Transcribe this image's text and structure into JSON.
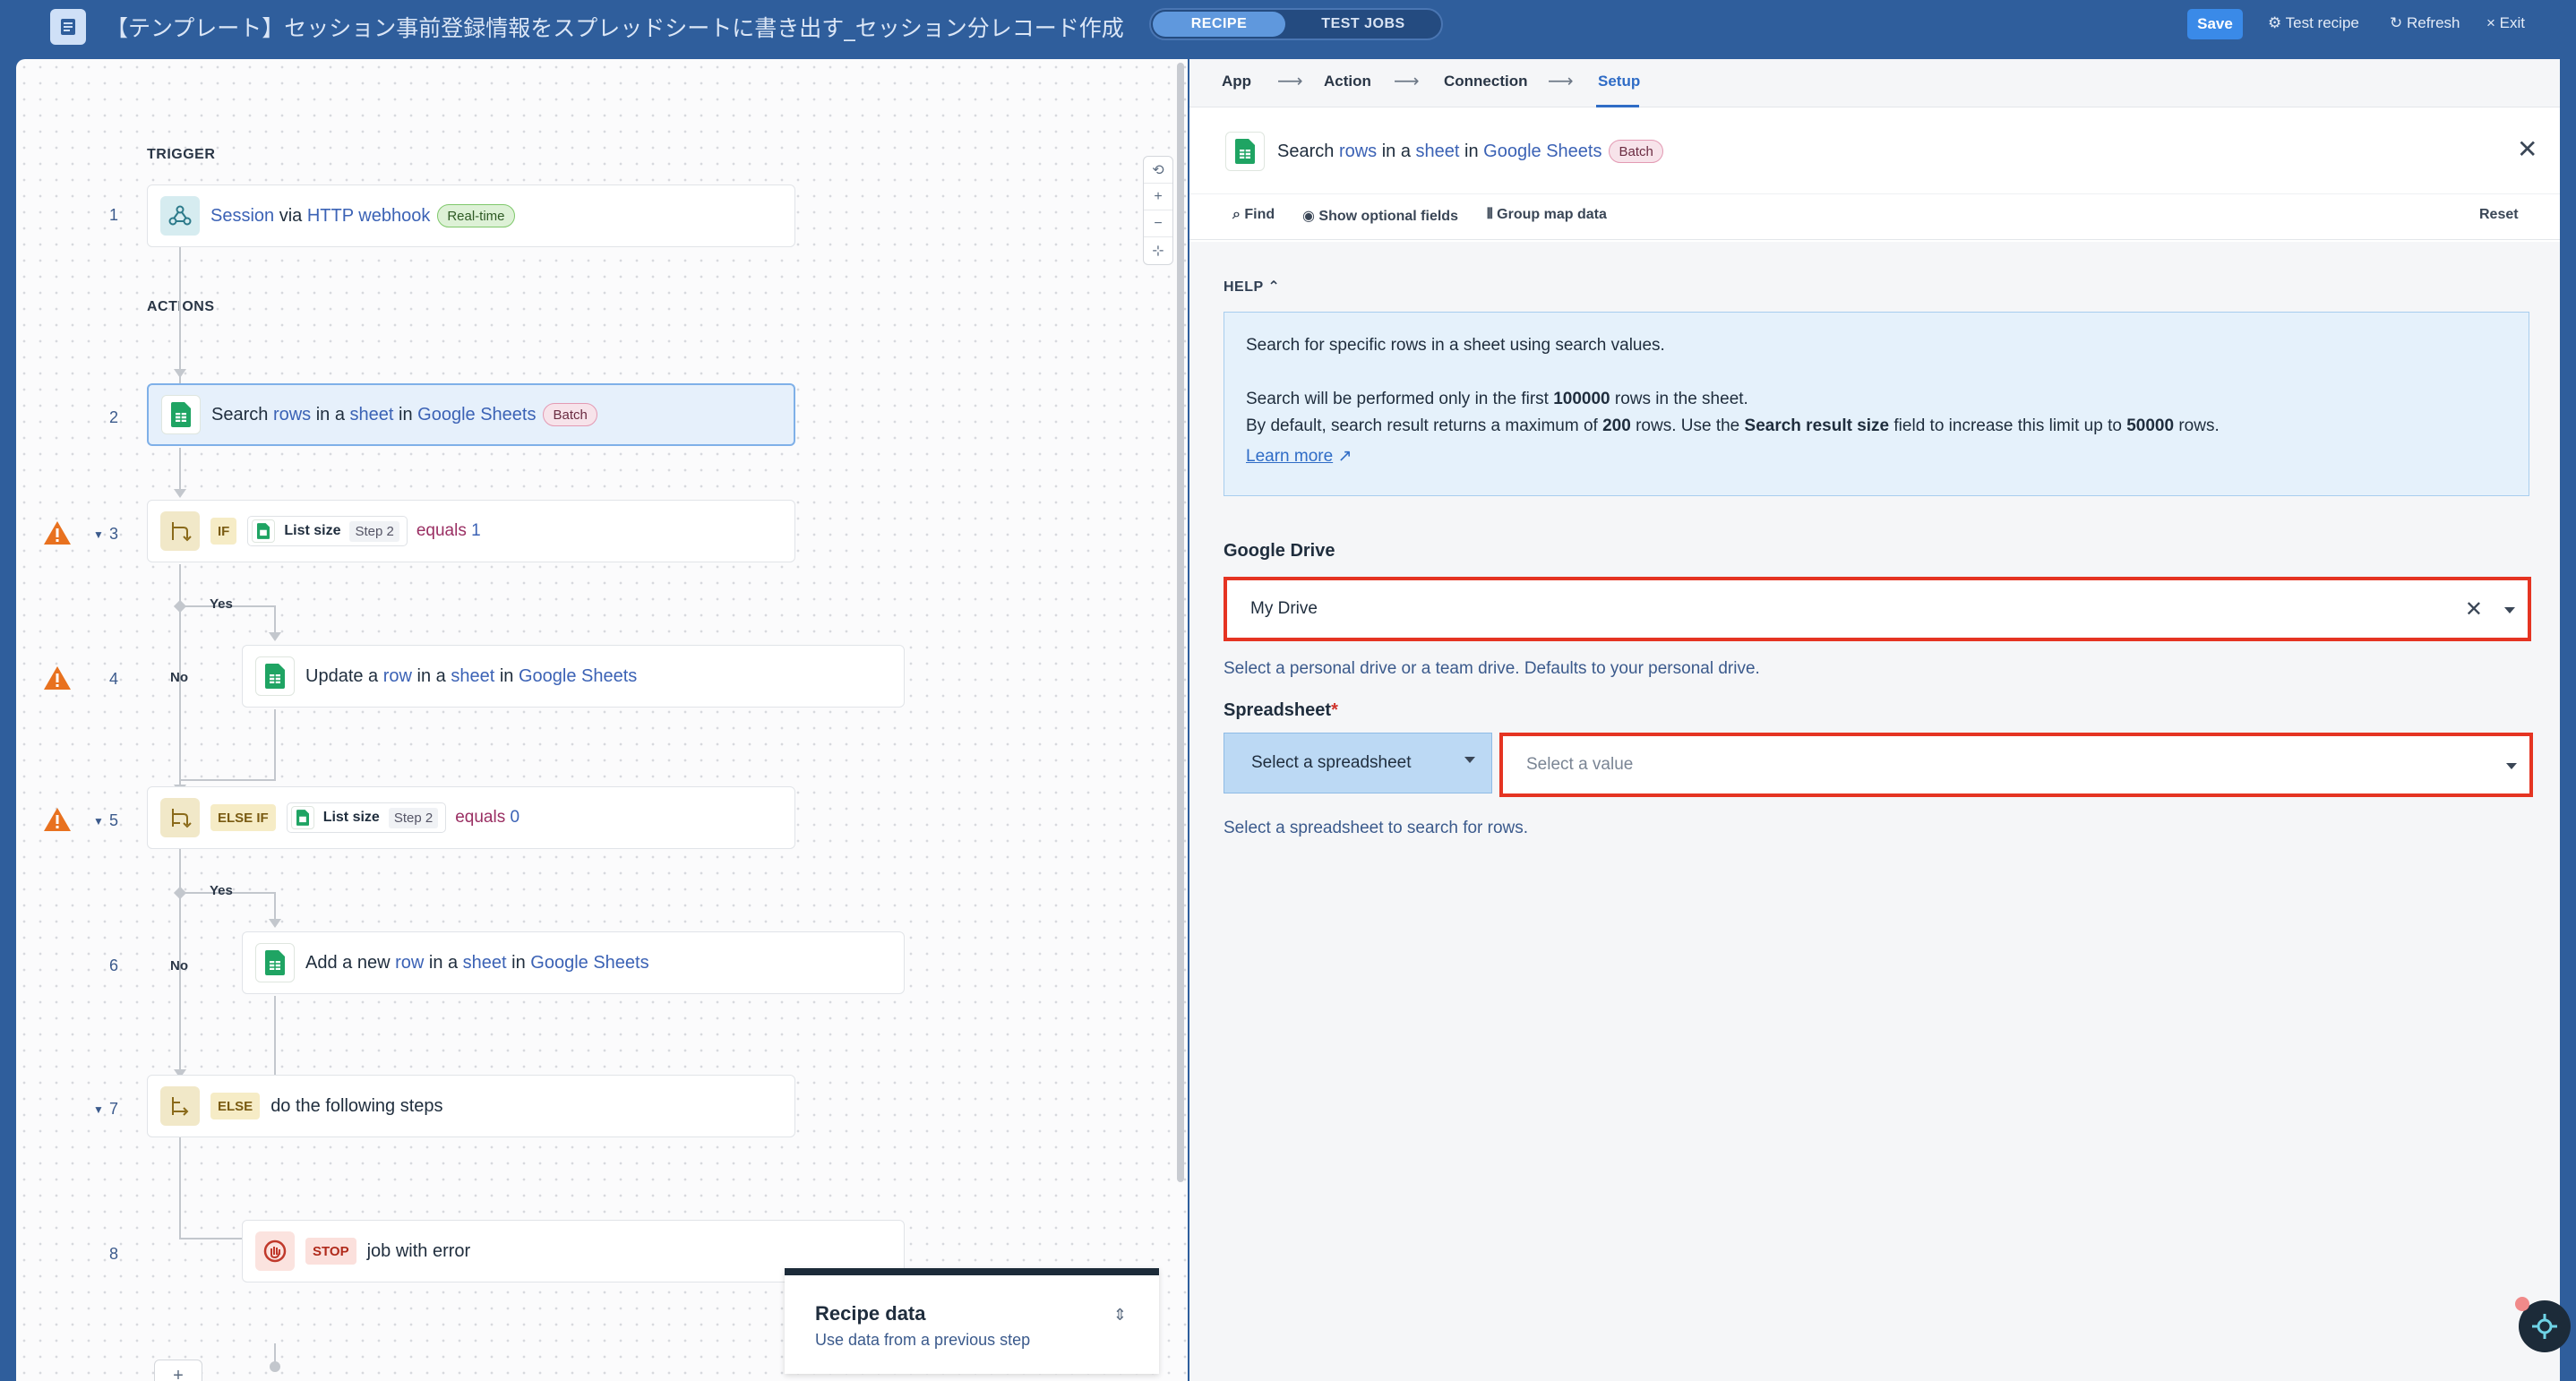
{
  "header": {
    "title": "【テンプレート】セッション事前登録情報をスプレッドシートに書き出す_セッション分レコード作成",
    "tabs": {
      "recipe": "RECIPE",
      "test_jobs": "TEST JOBS"
    },
    "save": "Save",
    "test_recipe": "Test recipe",
    "refresh": "Refresh",
    "exit": "Exit"
  },
  "canvas": {
    "trigger_label": "TRIGGER",
    "actions_label": "ACTIONS",
    "yes": "Yes",
    "no": "No",
    "steps": [
      {
        "num": "1",
        "parts": [
          "Session",
          " via ",
          "HTTP webhook"
        ],
        "badge": "Real-time"
      },
      {
        "num": "2",
        "parts": [
          "Search ",
          "rows",
          " in a ",
          "sheet",
          " in ",
          "Google Sheets"
        ],
        "badge": "Batch"
      },
      {
        "num": "3",
        "keyword": "IF",
        "chip_label": "List size",
        "chip_step": "Step 2",
        "cmp": "equals",
        "val": "1"
      },
      {
        "num": "4",
        "parts": [
          "Update a ",
          "row",
          " in a ",
          "sheet",
          " in ",
          "Google Sheets"
        ]
      },
      {
        "num": "5",
        "keyword": "ELSE IF",
        "chip_label": "List size",
        "chip_step": "Step 2",
        "cmp": "equals",
        "val": "0"
      },
      {
        "num": "6",
        "parts": [
          "Add a new ",
          "row",
          " in a ",
          "sheet",
          " in ",
          "Google Sheets"
        ]
      },
      {
        "num": "7",
        "keyword": "ELSE",
        "text": "do the following steps"
      },
      {
        "num": "8",
        "keyword": "STOP",
        "text": "job with error"
      }
    ],
    "recipe_data": {
      "title": "Recipe data",
      "subtitle": "Use data from a previous step"
    }
  },
  "panel": {
    "breadcrumbs": [
      "App",
      "Action",
      "Connection",
      "Setup"
    ],
    "title_parts": [
      "Search ",
      "rows",
      " in a ",
      "sheet",
      " in ",
      "Google Sheets"
    ],
    "title_badge": "Batch",
    "toolbar": {
      "find": "Find",
      "optional": "Show optional fields",
      "group": "Group map data",
      "reset": "Reset"
    },
    "help": {
      "label": "HELP",
      "line1": "Search for specific rows in a sheet using search values.",
      "line2a": "Search will be performed only in the first ",
      "line2b": "100000",
      "line2c": " rows in the sheet.",
      "line3a": "By default, search result returns a maximum of ",
      "line3b": "200",
      "line3c": " rows. Use the ",
      "line3d": "Search result size",
      "line3e": " field to increase this limit up to ",
      "line3f": "50000",
      "line3g": " rows.",
      "learn_more": "Learn more"
    },
    "google_drive": {
      "label": "Google Drive",
      "value": "My Drive",
      "hint": "Select a personal drive or a team drive. Defaults to your personal drive."
    },
    "spreadsheet": {
      "label": "Spreadsheet",
      "required": "*",
      "picker": "Select a spreadsheet",
      "placeholder": "Select a value",
      "hint": "Select a spreadsheet to search for rows."
    }
  },
  "colors": {
    "header_bg": "#2f5e9c",
    "highlight_border": "#e53422",
    "link": "#3b62b5",
    "accent": "#2f6cc6"
  }
}
